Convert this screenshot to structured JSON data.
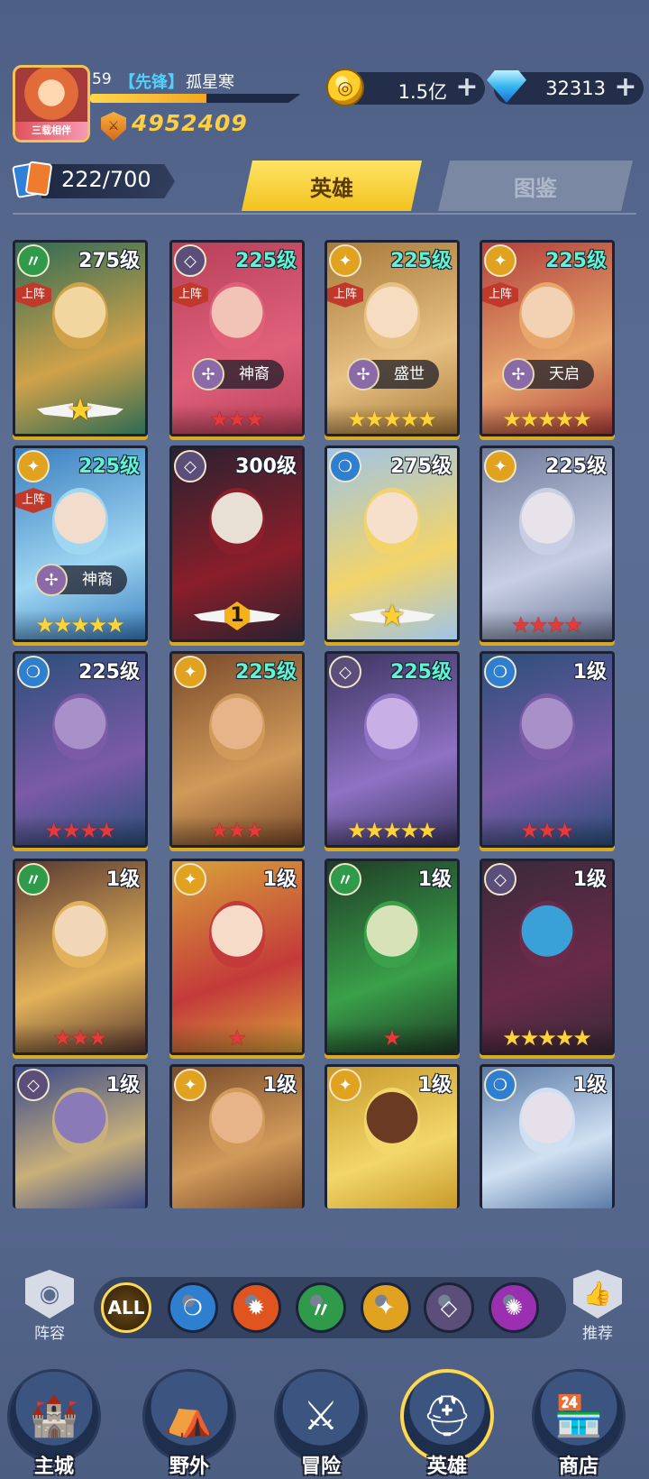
{
  "player": {
    "level": "59",
    "title": "【先锋】",
    "name": "孤星寒",
    "avatar_banner": "三载相伴",
    "xp_fraction": 0.55,
    "power": "4952409"
  },
  "resources": {
    "gold": "1.5亿",
    "gems": "32313",
    "plus": "+"
  },
  "roster": {
    "count": "222/700"
  },
  "tabs": {
    "heroes": "英雄",
    "codex": "图鉴"
  },
  "labels": {
    "deployed": "上阵"
  },
  "heroes": [
    {
      "level": "275级",
      "level_color": "white",
      "faction": "nature",
      "deployed": true,
      "skin": "",
      "stars": 0,
      "star_color": "",
      "emblem": "star",
      "art": [
        "#2f6b54",
        "#cfa24a",
        "#f2d6a0"
      ]
    },
    {
      "level": "225级",
      "level_color": "teal",
      "faction": "void",
      "deployed": true,
      "skin": "神裔",
      "stars": 3,
      "star_color": "red",
      "emblem": "",
      "art": [
        "#b8405a",
        "#e0607a",
        "#f2c4b8"
      ]
    },
    {
      "level": "225级",
      "level_color": "teal",
      "faction": "light",
      "deployed": true,
      "skin": "盛世",
      "stars": 5,
      "star_color": "gold",
      "emblem": "",
      "art": [
        "#a87a3a",
        "#e7c184",
        "#f6dcc0"
      ]
    },
    {
      "level": "225级",
      "level_color": "teal",
      "faction": "light",
      "deployed": true,
      "skin": "天启",
      "stars": 5,
      "star_color": "gold",
      "emblem": "",
      "art": [
        "#b2403c",
        "#e6a66c",
        "#f3d2b4"
      ]
    },
    {
      "level": "225级",
      "level_color": "teal",
      "faction": "light",
      "deployed": true,
      "skin": "神裔",
      "stars": 5,
      "star_color": "gold",
      "emblem": "",
      "art": [
        "#3a7fbf",
        "#9fd6f2",
        "#f2dccc"
      ]
    },
    {
      "level": "300级",
      "level_color": "white",
      "faction": "void",
      "deployed": false,
      "skin": "",
      "stars": 0,
      "star_color": "",
      "emblem": "1",
      "art": [
        "#2a2130",
        "#8a1e2a",
        "#e8e0d4"
      ]
    },
    {
      "level": "275级",
      "level_color": "white",
      "faction": "water",
      "deployed": false,
      "skin": "",
      "stars": 0,
      "star_color": "",
      "emblem": "star",
      "art": [
        "#9fc4e6",
        "#f2d46a",
        "#f6e0cc"
      ]
    },
    {
      "level": "225级",
      "level_color": "white",
      "faction": "light",
      "deployed": false,
      "skin": "",
      "stars": 4,
      "star_color": "red",
      "emblem": "",
      "art": [
        "#6e7a9a",
        "#c8cfe4",
        "#e8e2ea"
      ]
    },
    {
      "level": "225级",
      "level_color": "white",
      "faction": "water",
      "deployed": false,
      "skin": "",
      "stars": 4,
      "star_color": "red",
      "emblem": "",
      "art": [
        "#2a4f7a",
        "#7b5aa6",
        "#a890c8"
      ]
    },
    {
      "level": "225级",
      "level_color": "teal",
      "faction": "light",
      "deployed": false,
      "skin": "",
      "stars": 3,
      "star_color": "red",
      "emblem": "",
      "art": [
        "#7a4a2a",
        "#d09a5a",
        "#e6b488"
      ]
    },
    {
      "level": "225级",
      "level_color": "teal",
      "faction": "void",
      "deployed": false,
      "skin": "",
      "stars": 5,
      "star_color": "gold",
      "emblem": "",
      "art": [
        "#3b3560",
        "#8e72c4",
        "#c8b0e6"
      ]
    },
    {
      "level": "1级",
      "level_color": "white",
      "faction": "water",
      "deployed": false,
      "skin": "",
      "stars": 3,
      "star_color": "red",
      "emblem": "",
      "art": [
        "#2a4f7a",
        "#7b5aa6",
        "#a890c8"
      ]
    },
    {
      "level": "1级",
      "level_color": "white",
      "faction": "nature",
      "deployed": false,
      "skin": "",
      "stars": 3,
      "star_color": "red",
      "emblem": "",
      "art": [
        "#5a3a32",
        "#e2b25a",
        "#f2d6b8"
      ]
    },
    {
      "level": "1级",
      "level_color": "white",
      "faction": "light",
      "deployed": false,
      "skin": "",
      "stars": 1,
      "star_color": "red",
      "emblem": "",
      "art": [
        "#d8a23a",
        "#c43a3a",
        "#f6dcc8"
      ]
    },
    {
      "level": "1级",
      "level_color": "white",
      "faction": "nature",
      "deployed": false,
      "skin": "",
      "stars": 1,
      "star_color": "red",
      "emblem": "",
      "art": [
        "#1f3d26",
        "#3aa04a",
        "#d8e2b8"
      ]
    },
    {
      "level": "1级",
      "level_color": "white",
      "faction": "void",
      "deployed": false,
      "skin": "",
      "stars": 5,
      "star_color": "gold",
      "emblem": "",
      "art": [
        "#3a2a3a",
        "#6a2a4a",
        "#3aa0d8"
      ]
    },
    {
      "level": "1级",
      "level_color": "white",
      "faction": "void",
      "deployed": false,
      "skin": "",
      "stars": 0,
      "star_color": "",
      "emblem": "",
      "art": [
        "#3a4a8a",
        "#c8b07a",
        "#8a7ab8"
      ]
    },
    {
      "level": "1级",
      "level_color": "white",
      "faction": "light",
      "deployed": false,
      "skin": "",
      "stars": 0,
      "star_color": "",
      "emblem": "",
      "art": [
        "#7a4a2a",
        "#d09a5a",
        "#e6b488"
      ]
    },
    {
      "level": "1级",
      "level_color": "white",
      "faction": "light",
      "deployed": false,
      "skin": "",
      "stars": 0,
      "star_color": "",
      "emblem": "",
      "art": [
        "#c89a2a",
        "#f2d66a",
        "#6a3a22"
      ]
    },
    {
      "level": "1级",
      "level_color": "white",
      "faction": "water",
      "deployed": false,
      "skin": "",
      "stars": 0,
      "star_color": "",
      "emblem": "",
      "art": [
        "#5a7aa6",
        "#cfe0f2",
        "#e6e0ea"
      ]
    }
  ],
  "factions": {
    "nature": {
      "icon": "nature-icon",
      "color": "#2e9a4a"
    },
    "void": {
      "icon": "void-icon",
      "color": "#5b4f7a"
    },
    "light": {
      "icon": "light-icon",
      "color": "#e0a21f"
    },
    "water": {
      "icon": "water-icon",
      "color": "#2f7fd0"
    },
    "fire": {
      "icon": "fire-icon",
      "color": "#e0541f"
    },
    "chaos": {
      "icon": "chaos-icon",
      "color": "#9a2fb0"
    }
  },
  "filter": {
    "lineup_label": "阵容",
    "recommend_label": "推荐",
    "all_label": "ALL",
    "buttons": [
      "water",
      "fire",
      "nature",
      "light",
      "void",
      "chaos"
    ]
  },
  "nav": {
    "items": [
      {
        "label": "主城",
        "icon": "castle-icon",
        "active": false
      },
      {
        "label": "野外",
        "icon": "wilds-icon",
        "active": false
      },
      {
        "label": "冒险",
        "icon": "sword-icon",
        "active": false
      },
      {
        "label": "英雄",
        "icon": "knight-helmet-icon",
        "active": true
      },
      {
        "label": "商店",
        "icon": "shop-icon",
        "active": false
      }
    ]
  }
}
